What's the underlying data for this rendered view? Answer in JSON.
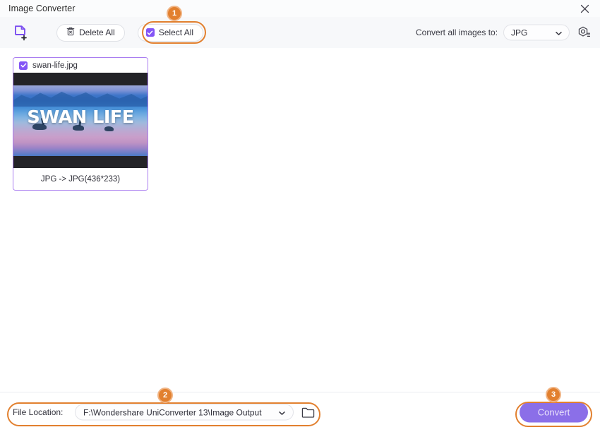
{
  "window": {
    "title": "Image Converter",
    "close_icon": "close-icon"
  },
  "toolbar": {
    "add_file_icon": "add-file-icon",
    "delete_all_label": "Delete All",
    "delete_all_icon": "trash-icon",
    "select_all_label": "Select All",
    "select_all_checked": true,
    "convert_to_label": "Convert all images to:",
    "format_value": "JPG",
    "format_chevron_icon": "chevron-down-icon",
    "settings_icon": "settings-hex-icon"
  },
  "files": [
    {
      "name": "swan-life.jpg",
      "checked": true,
      "thumbnail_text": "SWAN LIFE",
      "conversion": "JPG -> JPG(436*233)"
    }
  ],
  "bottom": {
    "file_location_label": "File Location:",
    "file_location_path": "F:\\Wondershare UniConverter 13\\Image Output",
    "path_chevron_icon": "chevron-down-icon",
    "folder_icon": "folder-icon",
    "convert_label": "Convert"
  },
  "annotations": {
    "badges": [
      {
        "number": "1",
        "target": "select-all-button"
      },
      {
        "number": "2",
        "target": "file-location-row"
      },
      {
        "number": "3",
        "target": "convert-button"
      }
    ],
    "highlight_color": "#e2802f"
  },
  "colors": {
    "accent_purple": "#8455f6",
    "convert_button": "#8b6fe8",
    "card_border": "#a97cf0",
    "toolbar_bg": "#f7f8fa",
    "annotation_orange": "#e2802f"
  }
}
